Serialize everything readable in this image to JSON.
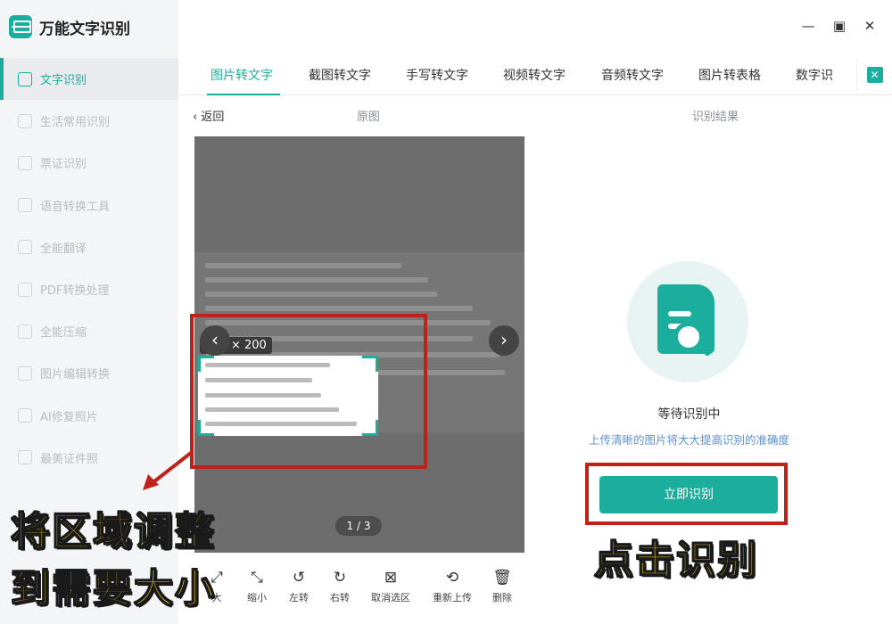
{
  "app": {
    "title": "万能文字识别"
  },
  "window_controls": {
    "minimize": "—",
    "maximize": "▣",
    "close": "✕"
  },
  "sidebar": {
    "items": [
      {
        "label": "文字识别",
        "active": true
      },
      {
        "label": "生活常用识别"
      },
      {
        "label": "票证识别"
      },
      {
        "label": "语音转换工具"
      },
      {
        "label": "全能翻译"
      },
      {
        "label": "PDF转换处理"
      },
      {
        "label": "全能压缩"
      },
      {
        "label": "图片编辑转换"
      },
      {
        "label": "AI修复照片"
      },
      {
        "label": "最美证件照"
      }
    ]
  },
  "tabs": [
    {
      "label": "图片转文字",
      "active": true
    },
    {
      "label": "截图转文字"
    },
    {
      "label": "手写转文字"
    },
    {
      "label": "视频转文字"
    },
    {
      "label": "音频转文字"
    },
    {
      "label": "图片转表格"
    },
    {
      "label": "数字识"
    }
  ],
  "subheader": {
    "back": "返回",
    "original": "原图",
    "result": "识别结果"
  },
  "image": {
    "selection_size": "444 × 200",
    "page_indicator": "1 / 3"
  },
  "toolbar": [
    {
      "label": "大",
      "icon": "zoom-in-icon"
    },
    {
      "label": "缩小",
      "icon": "zoom-out-icon"
    },
    {
      "label": "左转",
      "icon": "rotate-left-icon"
    },
    {
      "label": "右转",
      "icon": "rotate-right-icon"
    },
    {
      "label": "取消选区",
      "icon": "cancel-selection-icon"
    },
    {
      "label": "重新上传",
      "icon": "reupload-icon"
    },
    {
      "label": "删除",
      "icon": "delete-icon"
    }
  ],
  "result": {
    "status": "等待识别中",
    "hint": "上传清晰的图片将大大提高识别的准确度",
    "button": "立即识别"
  },
  "annotations": {
    "left_line1": "将区域调整",
    "left_line2": "到需要大小",
    "right": "点击识别"
  },
  "colors": {
    "accent": "#1cae9d",
    "annotation_box": "#c0211b",
    "annotation_text": "#f5d21e",
    "hint": "#5b93d6"
  }
}
